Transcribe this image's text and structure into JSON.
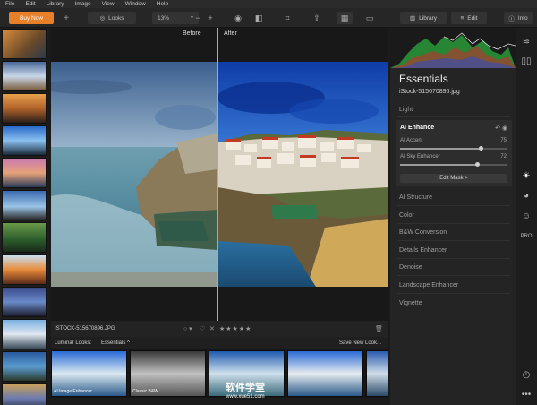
{
  "menu": [
    "File",
    "Edit",
    "Library",
    "Image",
    "View",
    "Window",
    "Help"
  ],
  "toolbar": {
    "buy_label": "Buy Now",
    "add_label": "+",
    "looks_label": "Looks",
    "zoom_value": "13%",
    "zoom_minus": "−",
    "zoom_plus": "+",
    "library_label": "Library",
    "edit_label": "Edit",
    "info_label": "Info"
  },
  "canvas": {
    "before_label": "Before",
    "after_label": "After"
  },
  "photo": {
    "filename": "ISTOCK-515670896.JPG",
    "rating_stars": 0
  },
  "looks": {
    "label": "Luminar Looks:",
    "category": "Essentials",
    "save_label": "Save New Look...",
    "items": [
      "AI Image Enhancer",
      "Classic B&W"
    ]
  },
  "panel": {
    "title": "Essentials",
    "filename": "iStock-515670896.jpg",
    "sections_top": [
      "Light"
    ],
    "ai_enhance": {
      "title": "AI Enhance",
      "accent_label": "AI Accent",
      "accent_value": "75",
      "accent_level": 0.75,
      "sky_label": "AI Sky Enhancer",
      "sky_value": "72",
      "sky_level": 0.72,
      "edit_mask_label": "Edit Mask >"
    },
    "sections": [
      "AI Structure",
      "Color",
      "B&W Conversion",
      "Details Enhancer",
      "Denoise",
      "Landscape Enhancer",
      "Vignette"
    ]
  },
  "watermark": {
    "text": "软件学堂",
    "url": "www.xue51.com"
  },
  "colors": {
    "accent": "#e8802a",
    "divider": "#e0a14a"
  }
}
